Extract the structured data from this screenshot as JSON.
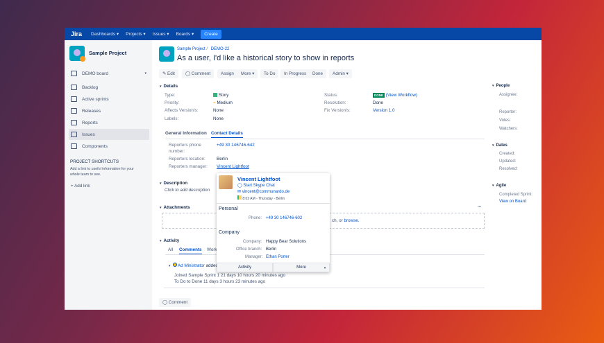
{
  "nav": {
    "logo": "Jira",
    "items": [
      "Dashboards ▾",
      "Projects ▾",
      "Issues ▾",
      "Boards ▾"
    ],
    "create": "Create"
  },
  "sidebar": {
    "project": "Sample Project",
    "board": "DEMO board",
    "items": [
      "Backlog",
      "Active sprints",
      "Releases",
      "Reports",
      "Issues",
      "Components"
    ],
    "shortcuts_title": "PROJECT SHORTCUTS",
    "shortcuts_text1": "Add a link to useful information for your",
    "shortcuts_text2": "whole team to see.",
    "add_link": "+ Add link"
  },
  "issue": {
    "breadcrumb_project": "Sample Project",
    "breadcrumb_sep": "/",
    "key": "DEMO-22",
    "title": "As a user, I'd like a historical story to show in reports"
  },
  "toolbar": {
    "edit": "✎ Edit",
    "comment": "◯ Comment",
    "assign": "Assign",
    "more": "More ▾",
    "todo": "To Do",
    "inprogress": "In Progress",
    "done": "Done",
    "admin": "Admin ▾"
  },
  "details": {
    "title": "Details",
    "type_l": "Type:",
    "type": "Story",
    "priority_l": "Priority:",
    "priority": "Medium",
    "affects_l": "Affects Version/s:",
    "affects": "None",
    "labels_l": "Labels:",
    "labels": "None",
    "status_l": "Status:",
    "status": "DONE",
    "workflow": "(View Workflow)",
    "resolution_l": "Resolution:",
    "resolution": "Done",
    "fix_l": "Fix Version/s:",
    "fix": "Version 1.0"
  },
  "tabs": {
    "general": "General Information",
    "contact": "Contact Details"
  },
  "contact": {
    "phone_l1": "Reporters phone",
    "phone_l2": "number:",
    "phone": "+49 30 146746-642",
    "location_l": "Reporters location:",
    "location": "Berlin",
    "manager_l": "Reporters manager:",
    "manager": "Vincent Lightfoot"
  },
  "description": {
    "title": "Description",
    "placeholder": "Click to add description"
  },
  "attachments": {
    "title": "Attachments",
    "more": "...",
    "drop_text": "ch, or ",
    "browse": "browse."
  },
  "activity": {
    "title": "Activity",
    "tabs": [
      "All",
      "Comments",
      "Work Log"
    ],
    "user": "Ad Ministrator",
    "action": "added a comment",
    "line1": "Joined Sample Sprint 1 21 days 10 hours 20 minutes ago",
    "line2": "To Do to Done 11 days 3 hours 23 minutes ago",
    "comment_btn": "◯ Comment"
  },
  "popup": {
    "name": "Vincent Lightfoot",
    "skype": "Start Skype Chat",
    "email": "vincent@communardo.de",
    "time": "8:02 AM - Thursday - Berlin",
    "personal": "Personal",
    "phone_l": "Phone:",
    "phone": "+49 30 146746-602",
    "company_h": "Company",
    "company_l": "Company:",
    "company": "Happy Bear Solutions",
    "branch_l": "Office branch:",
    "branch": "Berlin",
    "manager_l": "Manager:",
    "manager": "Ethan Porter",
    "activity": "Activity",
    "more": "More"
  },
  "right": {
    "people": "People",
    "assignee": "Assignee:",
    "reporter": "Reporter:",
    "votes": "Votes:",
    "watchers": "Watchers:",
    "dates": "Dates",
    "created": "Created:",
    "updated": "Updated:",
    "resolved": "Resolved:",
    "agile": "Agile",
    "sprint": "Completed Sprint:",
    "board": "View on Board"
  }
}
